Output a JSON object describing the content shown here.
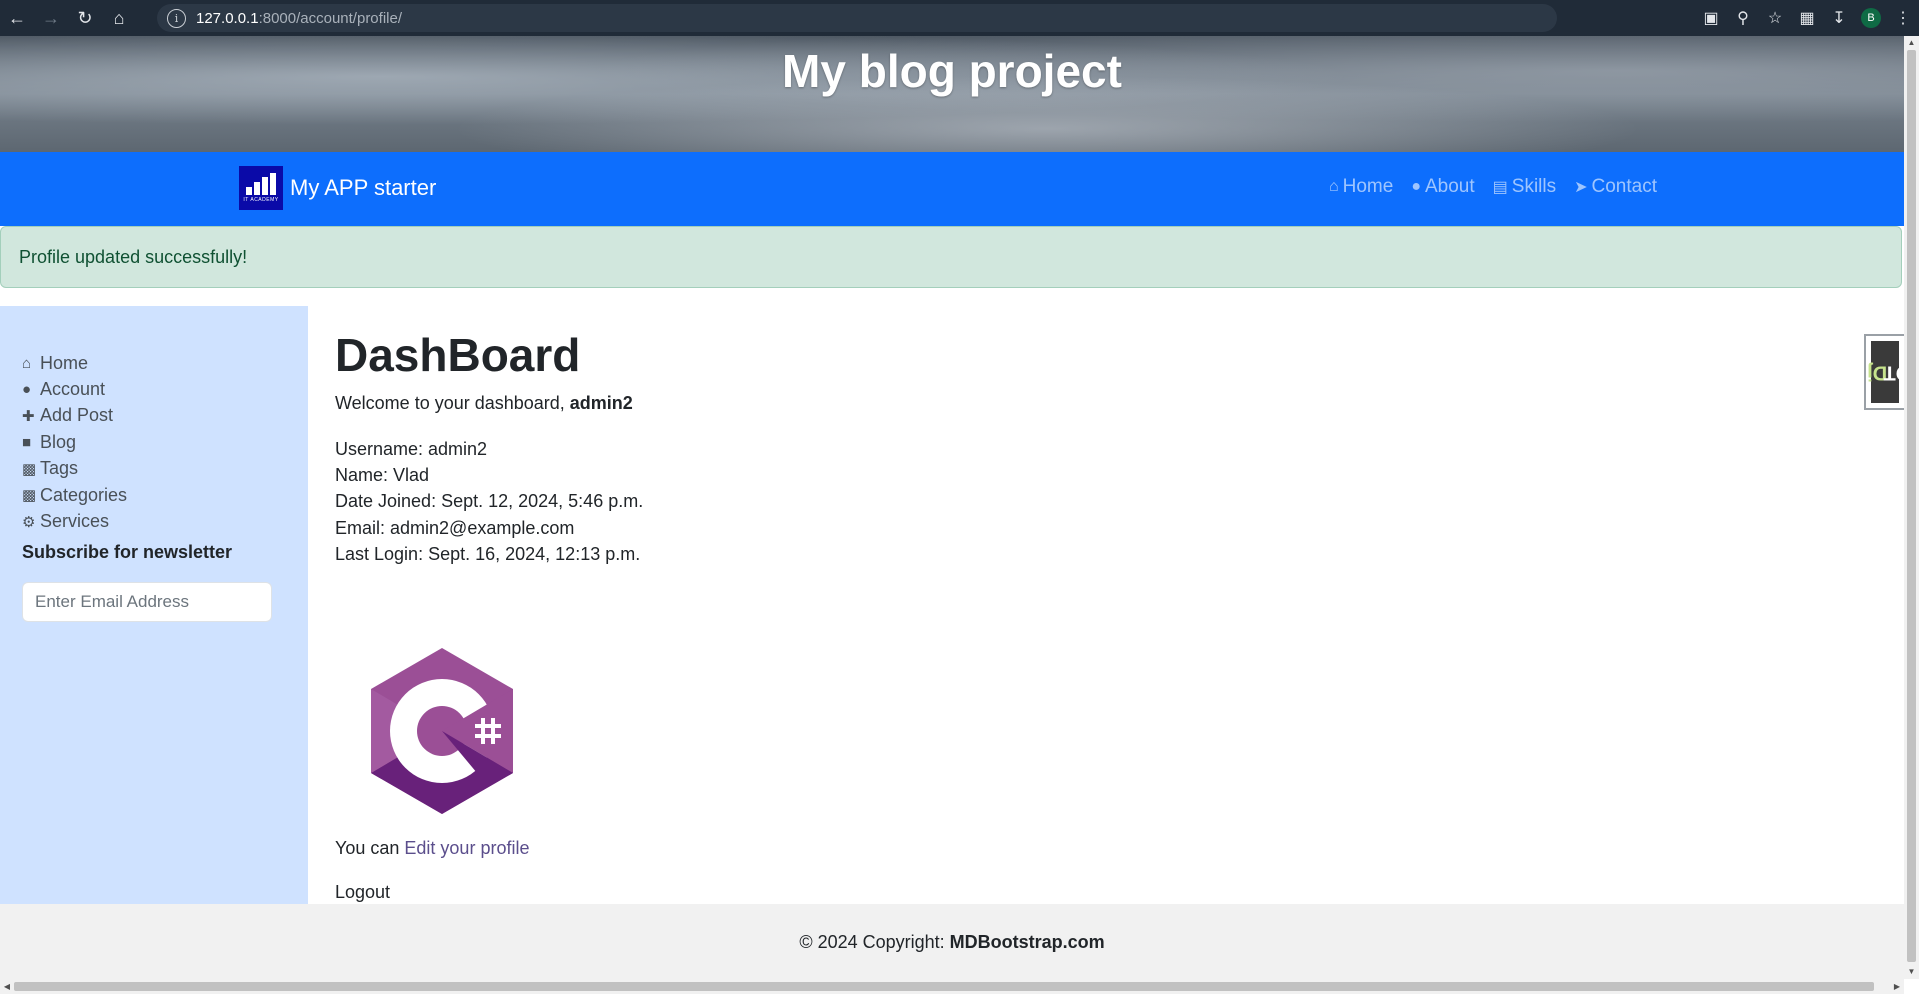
{
  "browser": {
    "url_host": "127.0.0.1",
    "url_path": ":8000/account/profile/",
    "profile_initial": "B"
  },
  "hero": {
    "title": "My blog project"
  },
  "navbar": {
    "brand": "My APP starter",
    "logo_caption": "IT ACADEMY",
    "links": [
      {
        "label": "Home",
        "icon": "home-icon"
      },
      {
        "label": "About",
        "icon": "user-icon"
      },
      {
        "label": "Skills",
        "icon": "book-icon"
      },
      {
        "label": "Contact",
        "icon": "paper-plane-icon"
      }
    ]
  },
  "alert": {
    "message": "Profile updated successfully!"
  },
  "sidebar": {
    "items": [
      {
        "label": "Home",
        "icon": "home-icon"
      },
      {
        "label": "Account",
        "icon": "user-icon"
      },
      {
        "label": "Add Post",
        "icon": "plus-icon"
      },
      {
        "label": "Blog",
        "icon": "sticky-note-icon"
      },
      {
        "label": "Tags",
        "icon": "briefcase-icon"
      },
      {
        "label": "Categories",
        "icon": "briefcase-icon"
      },
      {
        "label": "Services",
        "icon": "gears-icon"
      }
    ],
    "newsletter_title": "Subscribe for newsletter",
    "email_placeholder": "Enter Email Address"
  },
  "main": {
    "title": "DashBoard",
    "welcome_prefix": "Welcome to your dashboard, ",
    "welcome_user": "admin2",
    "info": [
      "Username: admin2",
      "Name: Vlad",
      "Date Joined: Sept. 12, 2024, 5:46 p.m.",
      "Email: admin2@example.com",
      "Last Login: Sept. 16, 2024, 12:13 p.m."
    ],
    "avatar_alt": "C#",
    "edit_prefix": "You can ",
    "edit_link": "Edit your profile",
    "logout": "Logout"
  },
  "djdt": {
    "label_a": "Dj",
    "label_b": "DT"
  },
  "footer": {
    "prefix": "© 2024 Copyright: ",
    "brand": "MDBootstrap.com"
  },
  "colors": {
    "navbar": "#0d6efd",
    "alert_bg": "#d1e7dd",
    "sidebar_bg": "#cfe2ff",
    "footer_bg": "#f1f1f1",
    "avatar_purple": "#9b4f96"
  }
}
